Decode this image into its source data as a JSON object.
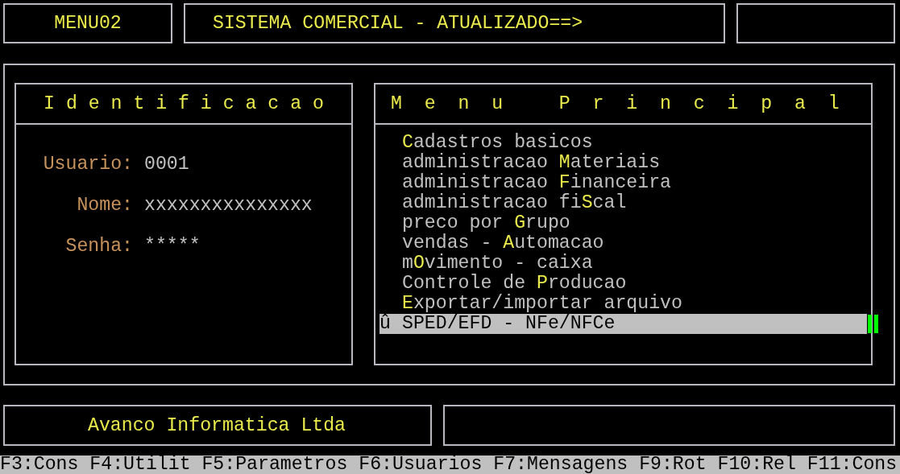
{
  "header": {
    "program": "MENU02",
    "title": "SISTEMA COMERCIAL - ATUALIZADO==>"
  },
  "identification": {
    "title": "I d e n t i f i c a c a o",
    "fields": [
      {
        "label": "Usuario:",
        "value": "0001"
      },
      {
        "label": "Nome:",
        "value": "xxxxxxxxxxxxxxx"
      },
      {
        "label": "Senha:",
        "value": "*****"
      }
    ]
  },
  "main_menu": {
    "title": "M  e  n  u     P  r  i  n  c  i  p  a  l",
    "items": [
      {
        "key": "C",
        "after": "adastros basicos",
        "selected": false
      },
      {
        "before": "administracao ",
        "key": "M",
        "after": "ateriais",
        "selected": false
      },
      {
        "before": "administracao ",
        "key": "F",
        "after": "inanceira",
        "selected": false
      },
      {
        "before": "administracao fi",
        "key": "S",
        "after": "cal",
        "selected": false
      },
      {
        "before": "preco por ",
        "key": "G",
        "after": "rupo",
        "selected": false
      },
      {
        "before": "vendas - ",
        "key": "A",
        "after": "utomacao",
        "selected": false
      },
      {
        "before": "m",
        "key": "O",
        "after": "vimento - caixa",
        "selected": false
      },
      {
        "before": "Controle de ",
        "key": "P",
        "after": "roducao",
        "selected": false
      },
      {
        "key": "E",
        "after": "xportar/importar arquivo",
        "selected": false
      },
      {
        "marker": "û",
        "before": "SPED/EFD - NFe/NFCe",
        "selected": true
      }
    ]
  },
  "footer": {
    "company": "Avanco Informatica Ltda"
  },
  "function_keys": [
    "F3:Cons",
    "F4:Utilit",
    "F5:Parametros",
    "F6:Usuarios",
    "F7:Mensagens",
    "F9:Rot",
    "F10:Rel",
    "F11:Cons"
  ]
}
